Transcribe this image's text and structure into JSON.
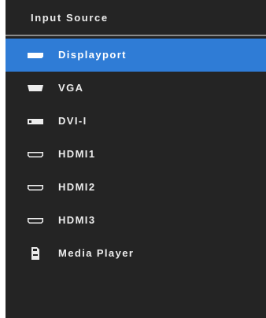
{
  "panel": {
    "title": "Input Source"
  },
  "colors": {
    "panel_background": "#242424",
    "selected_highlight": "#2f7cd6",
    "text": "#ededed",
    "divider": "#8a8a8a"
  },
  "items": [
    {
      "label": "Displayport",
      "icon": "displayport-icon",
      "selected": true
    },
    {
      "label": "VGA",
      "icon": "vga-icon",
      "selected": false
    },
    {
      "label": "DVI-I",
      "icon": "dvi-icon",
      "selected": false
    },
    {
      "label": "HDMI1",
      "icon": "hdmi-icon",
      "selected": false
    },
    {
      "label": "HDMI2",
      "icon": "hdmi-icon",
      "selected": false
    },
    {
      "label": "HDMI3",
      "icon": "hdmi-icon",
      "selected": false
    },
    {
      "label": "Media Player",
      "icon": "media-player-icon",
      "selected": false
    }
  ]
}
